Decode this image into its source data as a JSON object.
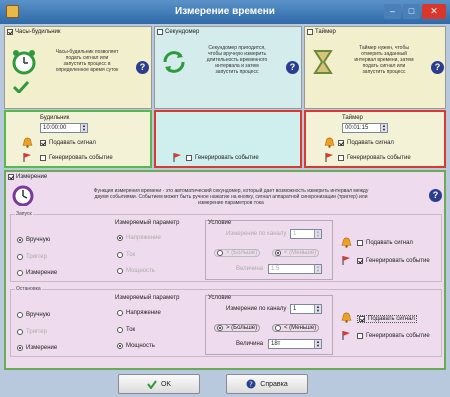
{
  "window": {
    "title": "Измерение времени",
    "min": "–",
    "max": "□",
    "close": "✕"
  },
  "stopwatch": {
    "caption": "Часы-будильник",
    "enabled": true,
    "desc": [
      "Часы-будильник позволяет",
      "подать сигнал или",
      "запустить процесс в",
      "определенное время суток"
    ],
    "field_label": "Будильник",
    "time": "10:00:00",
    "signal_label": "Подавать сигнал",
    "signal": true,
    "event_label": "Генерировать событие",
    "event": false
  },
  "second": {
    "caption": "Секундомер",
    "enabled": false,
    "desc": [
      "Секундомер пригодится,",
      "чтобы вручную измерить",
      "длительность временного",
      "интервала и затем",
      "запустить процесс"
    ],
    "event_label": "Генерировать событие",
    "event": false
  },
  "timer": {
    "caption": "Таймер",
    "enabled": false,
    "desc": [
      "Таймер нужен, чтобы",
      "отмерить заданный",
      "интервал времени, затем",
      "подать сигнал или",
      "запустить процесс"
    ],
    "field_label": "Таймер",
    "time": "00:01:15",
    "signal_label": "Подавать сигнал",
    "signal": true,
    "event_label": "Генерировать событие",
    "event": false
  },
  "measure": {
    "caption": "Измерение",
    "enabled": true,
    "desc": [
      "Функция измерения времени - это автоматический секундомер, который дает возможность измерить интервал между",
      "двумя событиями. Событием может быть ручное нажатие на кнопку, сигнал аппаратной синхронизации (триггер) или",
      "измерение параметров тока"
    ]
  },
  "start": {
    "title": "Запуск",
    "mode_manual": "Вручную",
    "mode_trigger": "Триггер",
    "mode_measure": "Измерение",
    "param_title": "Измеряемый параметр",
    "param_voltage": "Напряжение",
    "param_current": "Ток",
    "param_power": "Мощность",
    "cond_title": "Условие",
    "cond_channel": "Измерение по каналу",
    "channel": "1",
    "cond_more": "> (Больше)",
    "cond_less": "< (Меньше)",
    "value_label": "Величина",
    "value": "1.5",
    "signal_label": "Подавать сигнал",
    "signal": false,
    "event_label": "Генерировать событие",
    "event": true
  },
  "stop": {
    "title": "Остановка",
    "mode_manual": "Вручную",
    "mode_trigger": "Триггер",
    "mode_measure": "Измерение",
    "param_title": "Измеряемый параметр",
    "param_voltage": "Напряжение",
    "param_current": "Ток",
    "param_power": "Мощность",
    "cond_title": "Условие",
    "cond_channel": "Измерение по каналу",
    "channel": "1",
    "cond_more": "> (Больше)",
    "cond_less": "< (Меньше)",
    "value_label": "Величина",
    "value": "18т",
    "signal_label": "Подавать сигнал",
    "signal": true,
    "event_label": "Генерировать событие",
    "event": false
  },
  "buttons": {
    "ok": "OK",
    "help": "Справка"
  },
  "colors": {
    "green": "#59b84a",
    "red": "#d63a32",
    "panel_yellow": "#f2efcc",
    "panel_cyan": "#d4ecec",
    "pink": "#eedcee",
    "pink_border": "#6bab53",
    "title_blue": "#3f7bb8"
  }
}
